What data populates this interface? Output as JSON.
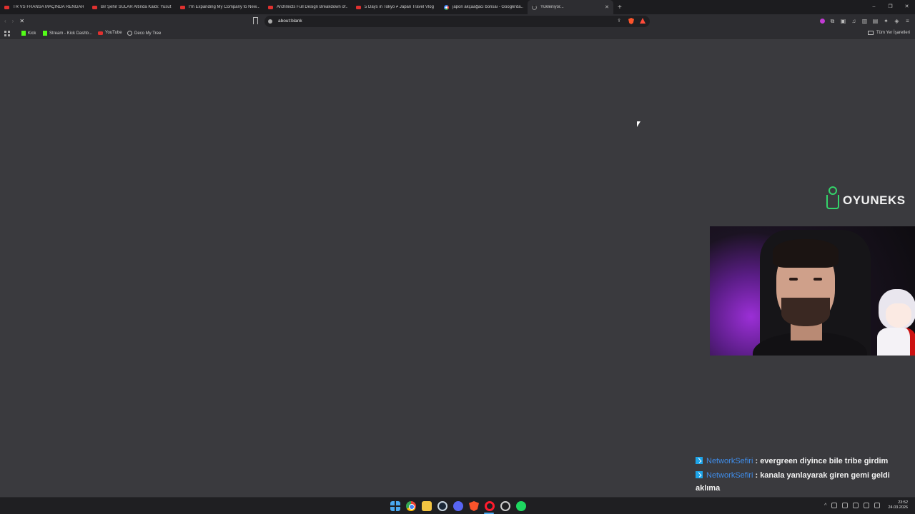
{
  "browser": {
    "tabs": [
      {
        "label": "TR VS FRANSA MAÇINDA RENGAR V...",
        "icon": "youtube-icon"
      },
      {
        "label": "Bir Şehir SULAR Altında Kaldı: Yusuf...",
        "icon": "youtube-icon"
      },
      {
        "label": "I'm Expanding My Company to New...",
        "icon": "youtube-icon"
      },
      {
        "label": "Architects Full Design Breakdown of...",
        "icon": "youtube-icon"
      },
      {
        "label": "5 Days in Tokyo ≠ Japan Travel Vlog",
        "icon": "youtube-icon"
      },
      {
        "label": "japon akçaağacı bonsai - Google'da...",
        "icon": "google-icon"
      },
      {
        "label": "Yükleniyor...",
        "icon": "loading-spinner-icon",
        "active": true
      }
    ],
    "new_tab_glyph": "+",
    "window_controls": {
      "minimize": "–",
      "restore": "❐",
      "close": "✕"
    },
    "nav": {
      "back": "‹",
      "forward": "›",
      "reload": "✕"
    },
    "url": "about:blank",
    "bookmarks": [
      {
        "label": "Kick",
        "icon": "kick-icon"
      },
      {
        "label": "Stream - Kick Dashb...",
        "icon": "kick-icon"
      },
      {
        "label": "YouTube",
        "icon": "youtube-icon"
      },
      {
        "label": "Deco My Tree",
        "icon": "globe-icon"
      }
    ],
    "all_bookmarks_label": "Tüm Yer İşaretleri"
  },
  "overlay": {
    "logo_text": "OYUNEKS",
    "chat": [
      {
        "user": "NetworkSefiri",
        "separator": " : ",
        "text": "evergreen diyince bile tribe girdim"
      },
      {
        "user": "NetworkSefiri",
        "separator": " : ",
        "text": "kanala yanlayarak giren gemi geldi aklıma"
      }
    ]
  },
  "taskbar": {
    "apps": [
      "windows-start-icon",
      "chrome-icon",
      "file-explorer-icon",
      "steam-icon",
      "discord-icon",
      "brave-icon",
      "opera-gx-icon",
      "vpn-icon",
      "spotify-icon"
    ],
    "tray": {
      "chevron": "^"
    },
    "time": "23:52",
    "date": "24.03.2026"
  },
  "colors": {
    "accent_green": "#34d36a",
    "chat_user": "#3f8ce8",
    "page_bg": "#3a3a3e"
  }
}
